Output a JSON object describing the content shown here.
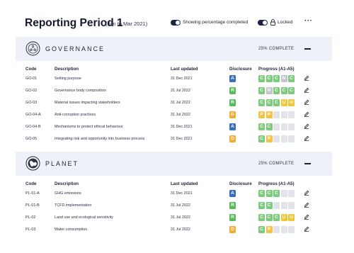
{
  "header": {
    "title": "Reporting Period 1",
    "subtitle": "(Jan to Mar 2021)",
    "toggle_percentage_label": "Showing percentage completed",
    "toggle_lock_label": "Locked",
    "more_icon": "more-horizontal-icon"
  },
  "columns": {
    "code": "Code",
    "description": "Description",
    "last_updated": "Last updated",
    "disclosure": "Disclosure",
    "progress": "Progress (A1-A5)"
  },
  "colors": {
    "A": "#3b6fb5",
    "R": "#5cb85c",
    "D": "#f0ad2f",
    "C": "#7ccb7c",
    "P": "#f5c242",
    "N": "#c3c5cc",
    "U": "#f0c63a",
    "empty": "#e2e4e9",
    "band": "#eef2f8"
  },
  "sections": [
    {
      "name": "GOVERNANCE",
      "icon": "governance-icon",
      "percent_label": "25% COMPLETE",
      "rows": [
        {
          "code": "GO-01",
          "description": "Setting purpose",
          "date": "31 Dec 2021",
          "disclosure": "A",
          "progress": [
            "C",
            "C",
            "C",
            "N",
            "C"
          ]
        },
        {
          "code": "GO-02",
          "description": "Governance body composition",
          "date": "31 Jul 2022",
          "disclosure": "R",
          "progress": [
            "C",
            "N",
            "C",
            "C",
            "C"
          ]
        },
        {
          "code": "GO-03",
          "description": "Material issues impacting stakeholders",
          "date": "31 Jul 2022",
          "disclosure": "R",
          "progress": [
            "C",
            "C",
            "C",
            "U",
            "U"
          ]
        },
        {
          "code": "GO-04-A",
          "description": "Anti-corruption practices",
          "date": "31 Jul 2022",
          "disclosure": "D",
          "progress": [
            "P",
            "P",
            "",
            "",
            ""
          ]
        },
        {
          "code": "GO-04-B",
          "description": "Mechanisms to protect ethical behaviour",
          "date": "31 Dec 2021",
          "disclosure": "A",
          "progress": [
            "C",
            "C",
            "",
            "",
            ""
          ]
        },
        {
          "code": "GO-05",
          "description": "Integrating risk and opportunity into business process",
          "date": "31 Dec 2021",
          "disclosure": "D",
          "progress": [
            "C",
            "P",
            "",
            "",
            ""
          ]
        }
      ]
    },
    {
      "name": "PLANET",
      "icon": "globe-icon",
      "percent_label": "25% COMPLETE",
      "rows": [
        {
          "code": "PL-01-A",
          "description": "GHG emissions",
          "date": "31 Dec 2021",
          "disclosure": "A",
          "progress": [
            "C",
            "C",
            "C",
            "",
            ""
          ]
        },
        {
          "code": "PL-01-B",
          "description": "TCFD implementation",
          "date": "31 Jul 2022",
          "disclosure": "R",
          "progress": [
            "C",
            "C",
            "",
            "",
            ""
          ]
        },
        {
          "code": "PL-02",
          "description": "Land use and ecological sensitivity",
          "date": "31 Jul 2022",
          "disclosure": "R",
          "progress": [
            "C",
            "C",
            "C",
            "U",
            "U"
          ]
        },
        {
          "code": "PL-03",
          "description": "Water consumption",
          "date": "31 Jul 2022",
          "disclosure": "D",
          "progress": [
            "C",
            "P",
            "",
            "",
            ""
          ]
        }
      ]
    }
  ]
}
